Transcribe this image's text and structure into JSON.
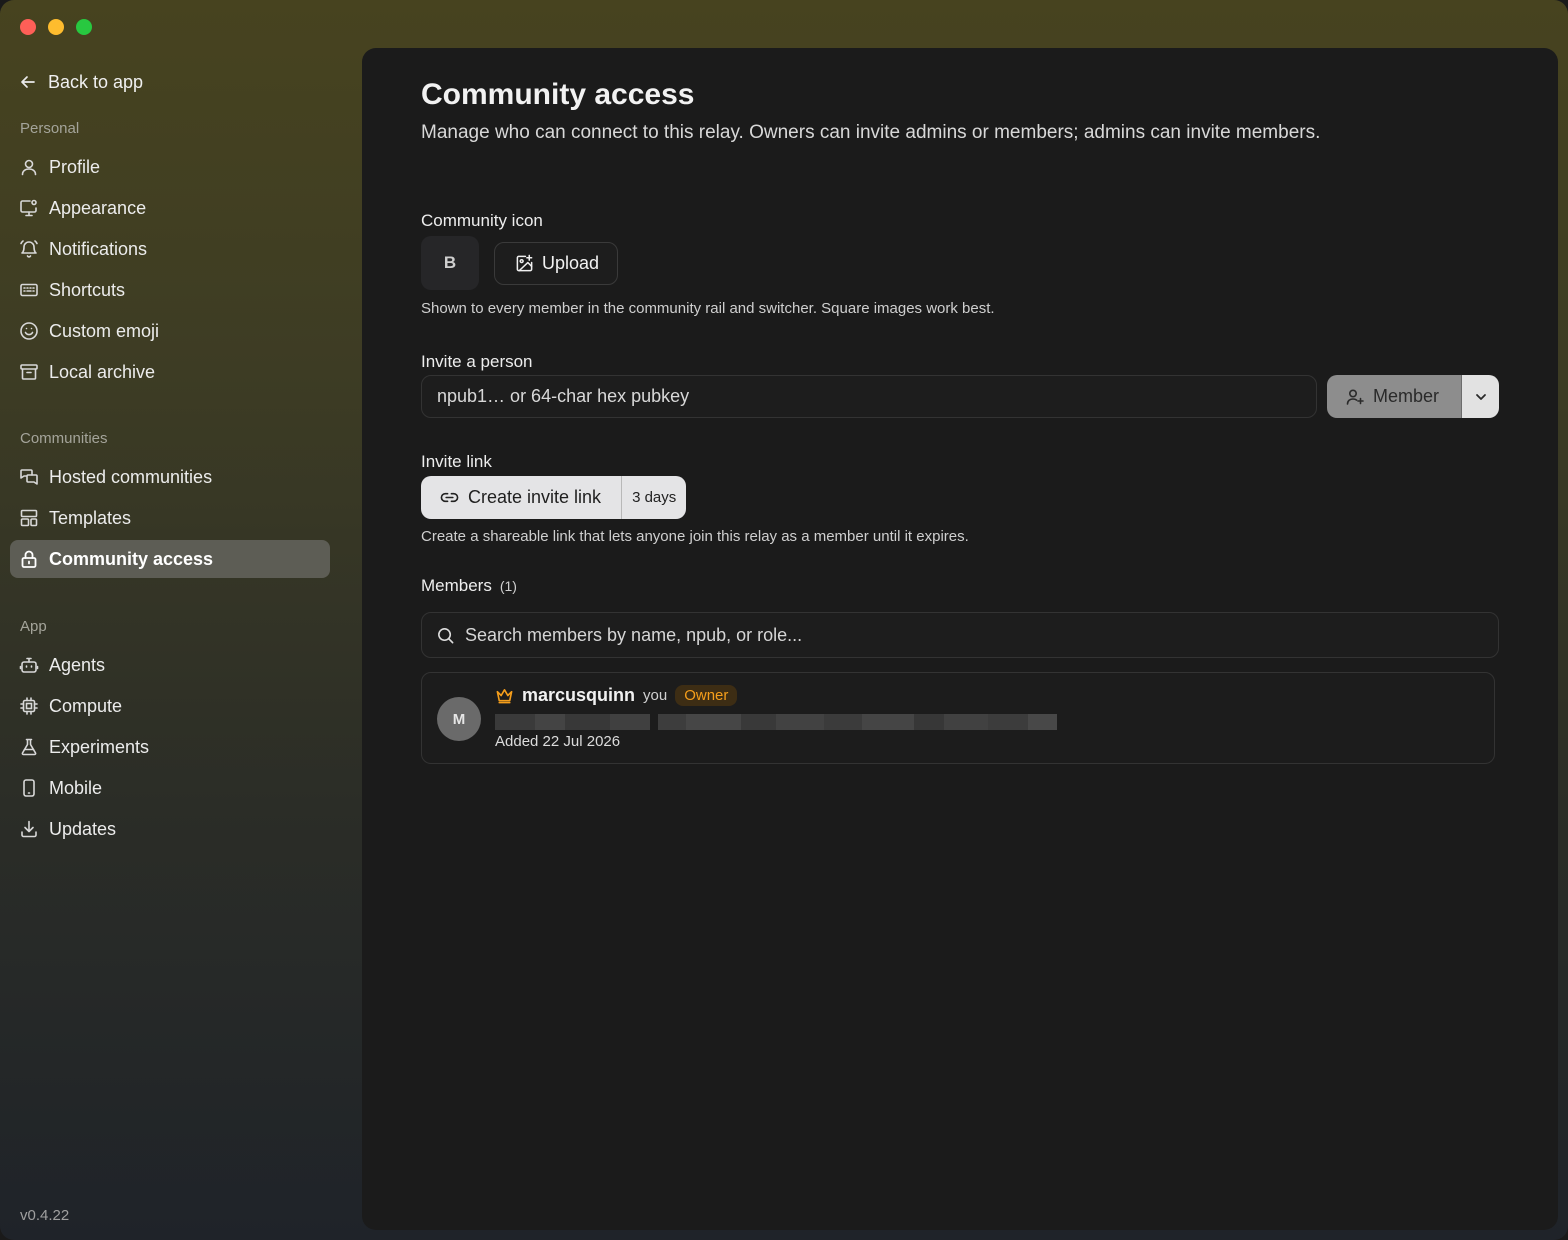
{
  "sidebar": {
    "back_label": "Back to app",
    "sections": {
      "personal": "Personal",
      "communities": "Communities",
      "app": "App"
    },
    "items": {
      "profile": "Profile",
      "appearance": "Appearance",
      "notifications": "Notifications",
      "shortcuts": "Shortcuts",
      "custom_emoji": "Custom emoji",
      "local_archive": "Local archive",
      "hosted_communities": "Hosted communities",
      "templates": "Templates",
      "community_access": "Community access",
      "agents": "Agents",
      "compute": "Compute",
      "experiments": "Experiments",
      "mobile": "Mobile",
      "updates": "Updates"
    },
    "active_item": "community_access",
    "version": "v0.4.22"
  },
  "page": {
    "title": "Community access",
    "subtitle": "Manage who can connect to this relay. Owners can invite admins or members; admins can invite members."
  },
  "community_icon": {
    "label": "Community icon",
    "initial": "B",
    "upload_label": "Upload",
    "hint": "Shown to every member in the community rail and switcher. Square images work best."
  },
  "invite_person": {
    "label": "Invite a person",
    "placeholder": "npub1… or 64-char hex pubkey",
    "role_label": "Member"
  },
  "invite_link": {
    "label": "Invite link",
    "create_label": "Create invite link",
    "duration": "3 days",
    "hint": "Create a shareable link that lets anyone join this relay as a member until it expires."
  },
  "members": {
    "heading": "Members",
    "count": "(1)",
    "search_placeholder": "Search members by name, npub, or role...",
    "list": [
      {
        "initial": "M",
        "name": "marcusquinn",
        "you_label": "you",
        "role": "Owner",
        "added": "Added 22 Jul 2026"
      }
    ]
  },
  "colors": {
    "accent_owner": "#f59e1b",
    "active_nav": "#5d5d55"
  }
}
